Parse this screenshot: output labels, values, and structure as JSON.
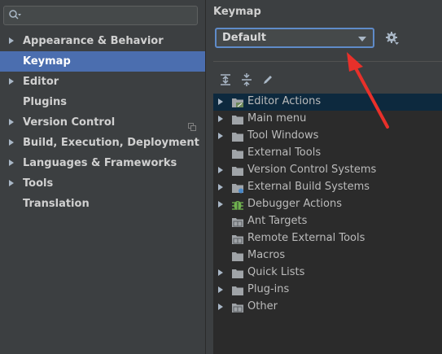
{
  "search": {
    "value": "",
    "placeholder": ""
  },
  "sidebar": {
    "items": [
      {
        "label": "Appearance & Behavior",
        "arrow": true,
        "selected": false
      },
      {
        "label": "Keymap",
        "arrow": false,
        "selected": true
      },
      {
        "label": "Editor",
        "arrow": true,
        "selected": false
      },
      {
        "label": "Plugins",
        "arrow": false,
        "selected": false
      },
      {
        "label": "Version Control",
        "arrow": true,
        "selected": false,
        "extra_icon": "copy-icon"
      },
      {
        "label": "Build, Execution, Deployment",
        "arrow": true,
        "selected": false
      },
      {
        "label": "Languages & Frameworks",
        "arrow": true,
        "selected": false
      },
      {
        "label": "Tools",
        "arrow": true,
        "selected": false
      },
      {
        "label": "Translation",
        "arrow": false,
        "selected": false
      }
    ]
  },
  "main": {
    "title": "Keymap",
    "keymap_select": {
      "value": "Default"
    },
    "toolbar": {
      "buttons": [
        {
          "name": "expand-all-icon"
        },
        {
          "name": "collapse-all-icon"
        },
        {
          "name": "edit-icon"
        }
      ]
    },
    "tree": {
      "items": [
        {
          "label": "Editor Actions",
          "arrow": true,
          "icon": "editor-actions-icon",
          "selected": true
        },
        {
          "label": "Main menu",
          "arrow": true,
          "icon": "folder-icon",
          "selected": false
        },
        {
          "label": "Tool Windows",
          "arrow": true,
          "icon": "folder-icon",
          "selected": false
        },
        {
          "label": "External Tools",
          "arrow": false,
          "icon": "folder-icon",
          "selected": false
        },
        {
          "label": "Version Control Systems",
          "arrow": true,
          "icon": "folder-icon",
          "selected": false
        },
        {
          "label": "External Build Systems",
          "arrow": true,
          "icon": "build-folder-icon",
          "selected": false
        },
        {
          "label": "Debugger Actions",
          "arrow": true,
          "icon": "bug-icon",
          "selected": false
        },
        {
          "label": "Ant Targets",
          "arrow": false,
          "icon": "folder-grid-icon",
          "selected": false
        },
        {
          "label": "Remote External Tools",
          "arrow": false,
          "icon": "folder-grid-icon",
          "selected": false
        },
        {
          "label": "Macros",
          "arrow": false,
          "icon": "folder-icon",
          "selected": false
        },
        {
          "label": "Quick Lists",
          "arrow": true,
          "icon": "folder-icon",
          "selected": false
        },
        {
          "label": "Plug-ins",
          "arrow": true,
          "icon": "folder-icon",
          "selected": false
        },
        {
          "label": "Other",
          "arrow": true,
          "icon": "folder-grid-icon",
          "selected": false
        }
      ]
    }
  },
  "colors": {
    "background": "#3c3f41",
    "tree_background": "#2b2b2b",
    "selection": "#4b6eaf",
    "tree_selection": "#0d293e",
    "annotation_arrow": "#e8302a",
    "folder": "#a0a4a8"
  }
}
